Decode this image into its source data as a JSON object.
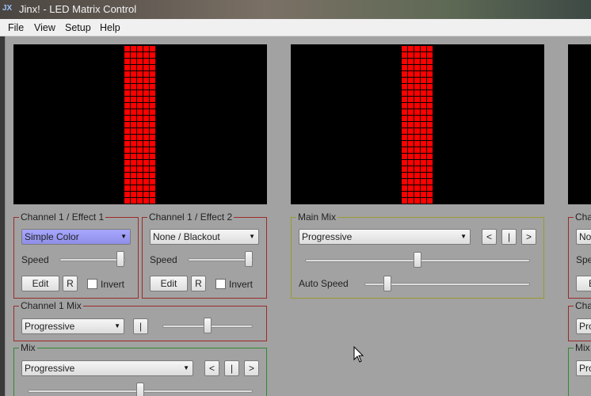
{
  "window": {
    "title": "Jinx! - LED Matrix Control",
    "icon": "JX"
  },
  "menu": [
    "File",
    "View",
    "Setup",
    "Help"
  ],
  "colors": {
    "led": "#ff0000",
    "effect_border": "#9b2a2a",
    "main_mix_border": "#9a9a30",
    "mix_border": "#2f8a2f",
    "combo_selected": "#8f8fe8"
  },
  "effect1": {
    "label": "Channel 1 / Effect 1",
    "combo": "Simple Color",
    "speed_label": "Speed",
    "speed_value": 0.97,
    "edit_label": "Edit",
    "r_label": "R",
    "invert_label": "Invert"
  },
  "effect2": {
    "label": "Channel 1 / Effect 2",
    "combo": "None / Blackout",
    "speed_label": "Speed",
    "speed_value": 0.97,
    "edit_label": "Edit",
    "r_label": "R",
    "invert_label": "Invert"
  },
  "channel_mix": {
    "label": "Channel 1 Mix",
    "combo": "Progressive",
    "toggle_label": "|",
    "slider_value": 0.5
  },
  "main_mix": {
    "label": "Main Mix",
    "combo": "Progressive",
    "prev_label": "<",
    "mid_label": "|",
    "next_label": ">",
    "slider_value": 0.5,
    "auto_speed_label": "Auto Speed",
    "auto_speed_value": 0.12
  },
  "mix": {
    "label": "Mix",
    "combo": "Progressive",
    "prev_label": "<",
    "mid_label": "|",
    "next_label": ">",
    "slider_value": 0.5
  },
  "right_partial": {
    "label1": "Chan",
    "combo1": "Non",
    "speed": "Spee",
    "edit": "E",
    "label2": "Chan",
    "combo2": "Pro",
    "label3": "Mix",
    "combo3": "Pro"
  }
}
